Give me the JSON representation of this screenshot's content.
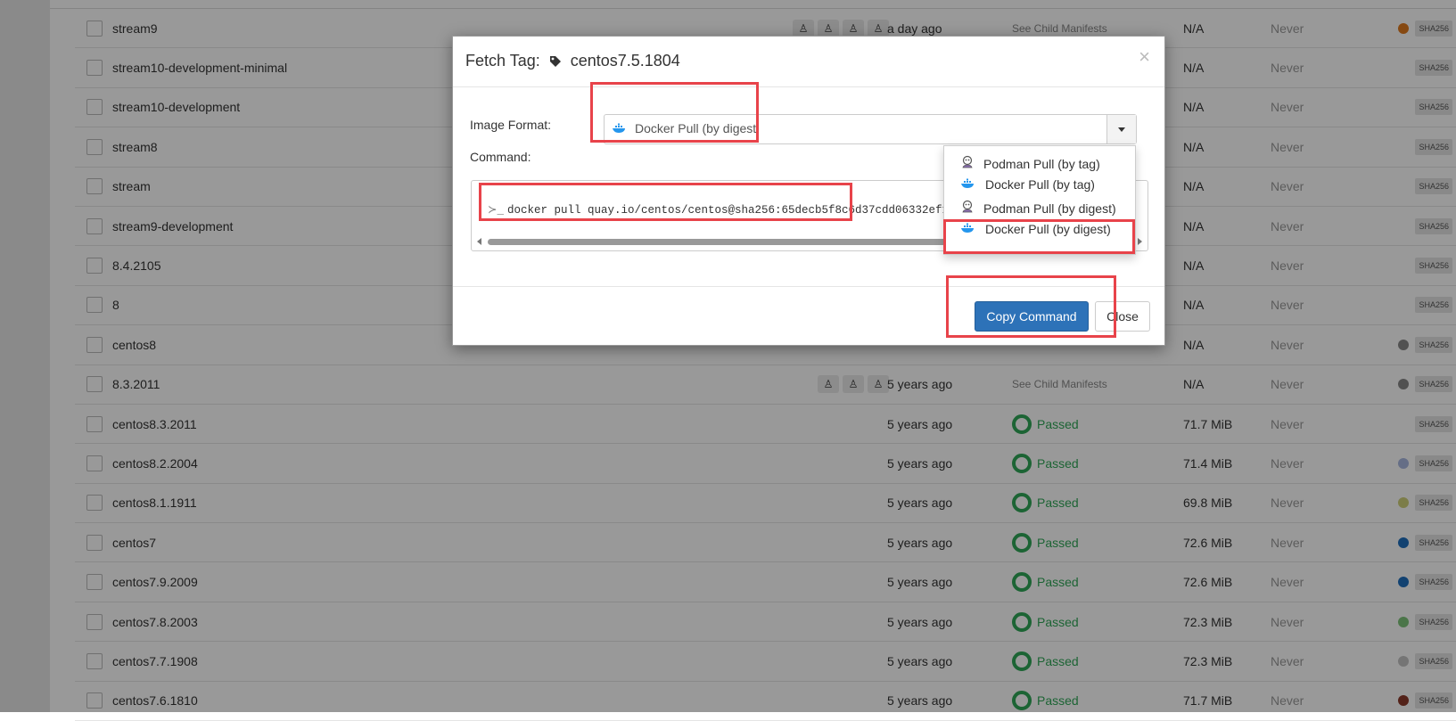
{
  "table": {
    "rows": [
      {
        "name": "stream9",
        "platforms": 4,
        "modified": "a day ago",
        "security": "See Child Manifests",
        "security_type": "child",
        "size": "N/A",
        "expires": "Never",
        "dot": "#e07a1f",
        "sha": "SHA256"
      },
      {
        "name": "stream10-development-minimal",
        "platforms": 0,
        "modified": "",
        "security": "",
        "security_type": "none",
        "size": "N/A",
        "expires": "Never",
        "dot": "",
        "sha": "SHA256"
      },
      {
        "name": "stream10-development",
        "platforms": 0,
        "modified": "",
        "security": "",
        "security_type": "none",
        "size": "N/A",
        "expires": "Never",
        "dot": "",
        "sha": "SHA256"
      },
      {
        "name": "stream8",
        "platforms": 0,
        "modified": "",
        "security": "",
        "security_type": "none",
        "size": "N/A",
        "expires": "Never",
        "dot": "",
        "sha": "SHA256"
      },
      {
        "name": "stream",
        "platforms": 0,
        "modified": "",
        "security": "",
        "security_type": "none",
        "size": "N/A",
        "expires": "Never",
        "dot": "",
        "sha": "SHA256"
      },
      {
        "name": "stream9-development",
        "platforms": 0,
        "modified": "",
        "security": "",
        "security_type": "none",
        "size": "N/A",
        "expires": "Never",
        "dot": "",
        "sha": "SHA256"
      },
      {
        "name": "8.4.2105",
        "platforms": 0,
        "modified": "",
        "security": "",
        "security_type": "none",
        "size": "N/A",
        "expires": "Never",
        "dot": "",
        "sha": "SHA256"
      },
      {
        "name": "8",
        "platforms": 0,
        "modified": "",
        "security": "",
        "security_type": "none",
        "size": "N/A",
        "expires": "Never",
        "dot": "",
        "sha": "SHA256"
      },
      {
        "name": "centos8",
        "platforms": 0,
        "modified": "",
        "security": "",
        "security_type": "none",
        "size": "N/A",
        "expires": "Never",
        "dot": "#888888",
        "sha": "SHA256"
      },
      {
        "name": "8.3.2011",
        "platforms": 3,
        "modified": "5 years ago",
        "security": "See Child Manifests",
        "security_type": "child",
        "size": "N/A",
        "expires": "Never",
        "dot": "#888888",
        "sha": "SHA256"
      },
      {
        "name": "centos8.3.2011",
        "platforms": 0,
        "modified": "5 years ago",
        "security": "Passed",
        "security_type": "passed",
        "size": "71.7 MiB",
        "expires": "Never",
        "dot": "",
        "sha": "SHA256"
      },
      {
        "name": "centos8.2.2004",
        "platforms": 0,
        "modified": "5 years ago",
        "security": "Passed",
        "security_type": "passed",
        "size": "71.4 MiB",
        "expires": "Never",
        "dot": "#a9b8e0",
        "sha": "SHA256"
      },
      {
        "name": "centos8.1.1911",
        "platforms": 0,
        "modified": "5 years ago",
        "security": "Passed",
        "security_type": "passed",
        "size": "69.8 MiB",
        "expires": "Never",
        "dot": "#cfd07a",
        "sha": "SHA256"
      },
      {
        "name": "centos7",
        "platforms": 0,
        "modified": "5 years ago",
        "security": "Passed",
        "security_type": "passed",
        "size": "72.6 MiB",
        "expires": "Never",
        "dot": "#1f6fbd",
        "sha": "SHA256"
      },
      {
        "name": "centos7.9.2009",
        "platforms": 0,
        "modified": "5 years ago",
        "security": "Passed",
        "security_type": "passed",
        "size": "72.6 MiB",
        "expires": "Never",
        "dot": "#1f6fbd",
        "sha": "SHA256"
      },
      {
        "name": "centos7.8.2003",
        "platforms": 0,
        "modified": "5 years ago",
        "security": "Passed",
        "security_type": "passed",
        "size": "72.3 MiB",
        "expires": "Never",
        "dot": "#7ec47a",
        "sha": "SHA256"
      },
      {
        "name": "centos7.7.1908",
        "platforms": 0,
        "modified": "5 years ago",
        "security": "Passed",
        "security_type": "passed",
        "size": "72.3 MiB",
        "expires": "Never",
        "dot": "#c4c4c4",
        "sha": "SHA256"
      },
      {
        "name": "centos7.6.1810",
        "platforms": 0,
        "modified": "5 years ago",
        "security": "Passed",
        "security_type": "passed",
        "size": "71.7 MiB",
        "expires": "Never",
        "dot": "#8a3a2a",
        "sha": "SHA256"
      }
    ],
    "platform_icon": "linux-penguin-icon",
    "platform_glyph": "♙"
  },
  "modal": {
    "title_prefix": "Fetch Tag:",
    "tag_name": "centos7.5.1804",
    "close_glyph": "×",
    "image_format_label": "Image Format:",
    "image_format_value": "Docker Pull (by digest",
    "command_label": "Command:",
    "command_prompt": "≻_",
    "command_text": "docker pull quay.io/centos/centos@sha256:65decb5f8c6d37cdd06332ef1116",
    "copy_button": "Copy Command",
    "close_button": "Close"
  },
  "dropdown": {
    "options": [
      {
        "label": "Podman Pull (by tag)",
        "icon": "podman-icon"
      },
      {
        "label": "Docker Pull (by tag)",
        "icon": "docker-icon"
      },
      {
        "label": "Podman Pull (by digest)",
        "icon": "podman-icon"
      },
      {
        "label": "Docker Pull (by digest)",
        "icon": "docker-icon"
      }
    ],
    "selected_index": 3
  },
  "colors": {
    "primary": "#2d72b8",
    "passed": "#2fa757",
    "highlight": "#e8434a",
    "docker": "#2496ed"
  }
}
